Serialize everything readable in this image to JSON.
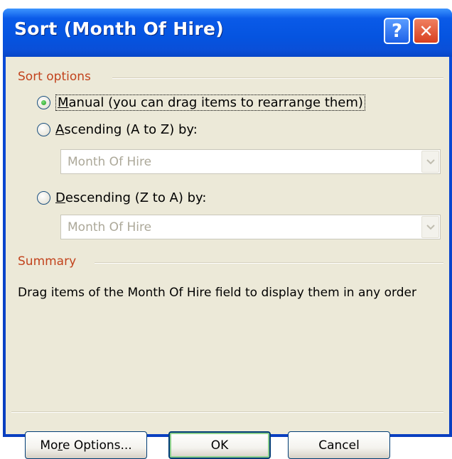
{
  "window": {
    "title": "Sort (Month Of Hire)",
    "help_label": "?",
    "close_label": "✕"
  },
  "sort_options": {
    "heading": "Sort options",
    "manual": {
      "label": "Manual (you can drag items to rearrange them)",
      "accel": "M",
      "rest": "anual (you can drag items to rearrange them)",
      "checked": true
    },
    "ascending": {
      "label": "Ascending (A to Z) by:",
      "accel": "A",
      "rest": "scending (A to Z) by:",
      "checked": false,
      "field": "Month Of Hire"
    },
    "descending": {
      "label": "Descending (Z to A) by:",
      "accel": "D",
      "rest": "escending (Z to A) by:",
      "checked": false,
      "field": "Month Of Hire"
    }
  },
  "summary": {
    "heading": "Summary",
    "text": "Drag items of the Month Of Hire field to display them in any order"
  },
  "buttons": {
    "more_options": {
      "pre": "Mo",
      "accel": "r",
      "post": "e Options..."
    },
    "ok": "OK",
    "cancel": "Cancel"
  },
  "colors": {
    "titlebar": "#0554e0",
    "section_heading": "#c2431d",
    "dialog_face": "#ece9d8",
    "disabled_text": "#aca899"
  }
}
